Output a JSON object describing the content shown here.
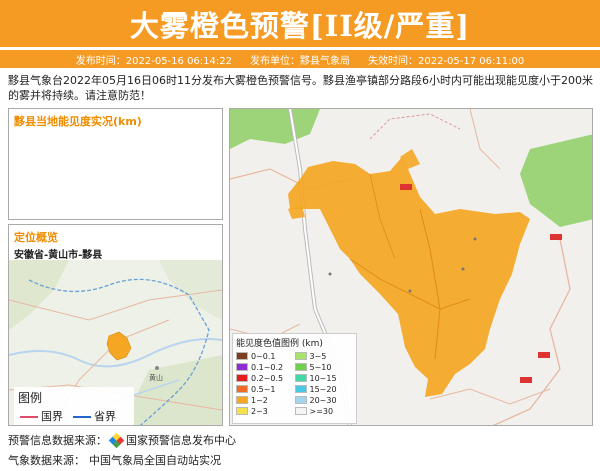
{
  "header": {
    "title": "大雾橙色预警[II级/严重]"
  },
  "meta": {
    "publish_time": "发布时间：2022-05-16 06:14:22",
    "publisher": "发布单位：黟县气象局",
    "expire_time": "失效时间：2022-05-17 06:11:00"
  },
  "description": "黟县气象台2022年05月16日06时11分发布大雾橙色预警信号。黟县渔亭镇部分路段6小时内可能出现能见度小于200米的雾并将持续。请注意防范！",
  "visibility_panel": {
    "title": "黟县当地能见度实况(km)"
  },
  "location_panel": {
    "title": "定位概览",
    "location": "安徽省-黄山市-黟县"
  },
  "small_map": {
    "labels": {
      "huangshan": "黄山"
    },
    "legend": {
      "title": "图例",
      "country_border": "国界",
      "province_border": "省界"
    }
  },
  "vis_legend": {
    "title": "能见度色值图例 (km)",
    "items": [
      {
        "label": "0~0.1",
        "color": "#7b3f1e"
      },
      {
        "label": "3~5",
        "color": "#a6e36b"
      },
      {
        "label": "0.1~0.2",
        "color": "#8e2bd6"
      },
      {
        "label": "5~10",
        "color": "#6fd24a"
      },
      {
        "label": "0.2~0.5",
        "color": "#e51c1c"
      },
      {
        "label": "10~15",
        "color": "#41d8a8"
      },
      {
        "label": "0.5~1",
        "color": "#f06a28"
      },
      {
        "label": "15~20",
        "color": "#46c8e6"
      },
      {
        "label": "1~2",
        "color": "#f5a623"
      },
      {
        "label": "20~30",
        "color": "#a5d4ee"
      },
      {
        "label": "2~3",
        "color": "#f5e24a"
      },
      {
        "label": ">=30",
        "color": "#f4f4f4"
      }
    ]
  },
  "footer": {
    "warning_source_label": "预警信息数据来源：",
    "warning_source": "国家预警信息发布中心",
    "weather_source_label": "气象数据来源：",
    "weather_source": "中国气象局全国自动站实况"
  },
  "colors": {
    "accent": "#f59a23",
    "fog_area": "#f5a623",
    "green_area": "#9dd47a"
  }
}
